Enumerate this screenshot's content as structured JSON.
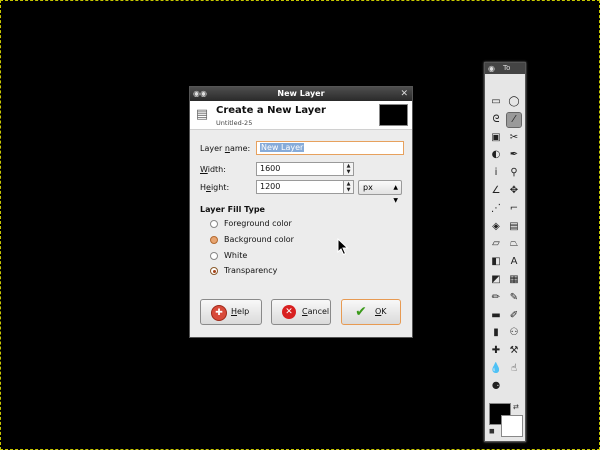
{
  "toolbox": {
    "title": "To"
  },
  "dialog": {
    "window_title": "New Layer",
    "header_title": "Create a New Layer",
    "header_subtitle": "Untitled-25",
    "layer_name_label_pre": "Layer ",
    "layer_name_label_mn": "n",
    "layer_name_label_post": "ame:",
    "layer_name_value": "New Layer",
    "width_label_pre": "",
    "width_label_mn": "W",
    "width_label_post": "idth:",
    "width_value": "1600",
    "height_label_pre": "H",
    "height_label_mn": "e",
    "height_label_post": "ight:",
    "height_value": "1200",
    "unit_value": "px",
    "fill_section_title": "Layer Fill Type",
    "fill_options": [
      {
        "label": "Foreground color"
      },
      {
        "label": "Background color"
      },
      {
        "label": "White"
      },
      {
        "label": "Transparency"
      }
    ],
    "selected_fill": "Transparency",
    "help_pre": "",
    "help_mn": "H",
    "help_post": "elp",
    "cancel_pre": "",
    "cancel_mn": "C",
    "cancel_post": "ancel",
    "ok_pre": "",
    "ok_mn": "O",
    "ok_post": "K"
  },
  "colors": {
    "canvas": "#000000",
    "selection_highlight": "#86abd9",
    "focus_border": "#e7a15e",
    "foreground_color": "#000000",
    "background_color": "#ffffff"
  }
}
